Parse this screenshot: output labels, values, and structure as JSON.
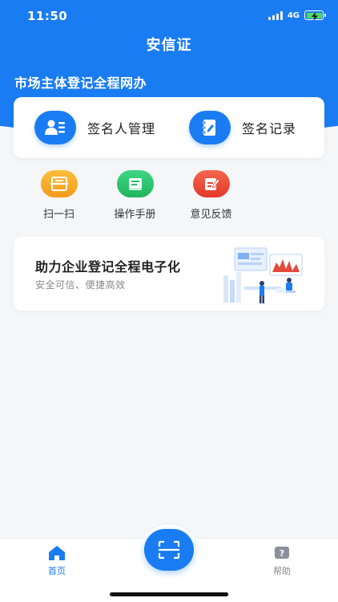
{
  "status_bar": {
    "time": "11:50",
    "network": "4G"
  },
  "header": {
    "title": "安信证",
    "section_title": "市场主体登记全程网办"
  },
  "signer_card": [
    {
      "label": "签名人管理",
      "icon": "person-card-icon"
    },
    {
      "label": "签名记录",
      "icon": "notebook-pen-icon"
    }
  ],
  "quick_actions": [
    {
      "label": "扫一扫",
      "icon": "scan-icon",
      "color": "#f5a623"
    },
    {
      "label": "操作手册",
      "icon": "book-icon",
      "color": "#2bc76b"
    },
    {
      "label": "意见反馈",
      "icon": "feedback-icon",
      "color": "#ee4b3a"
    }
  ],
  "banner": {
    "title": "助力企业登记全程电子化",
    "subtitle": "安全可信、便捷高效"
  },
  "tab_bar": {
    "home": "首页",
    "help": "帮助"
  },
  "colors": {
    "primary": "#1a7cf2",
    "background": "#f5f6f8"
  }
}
